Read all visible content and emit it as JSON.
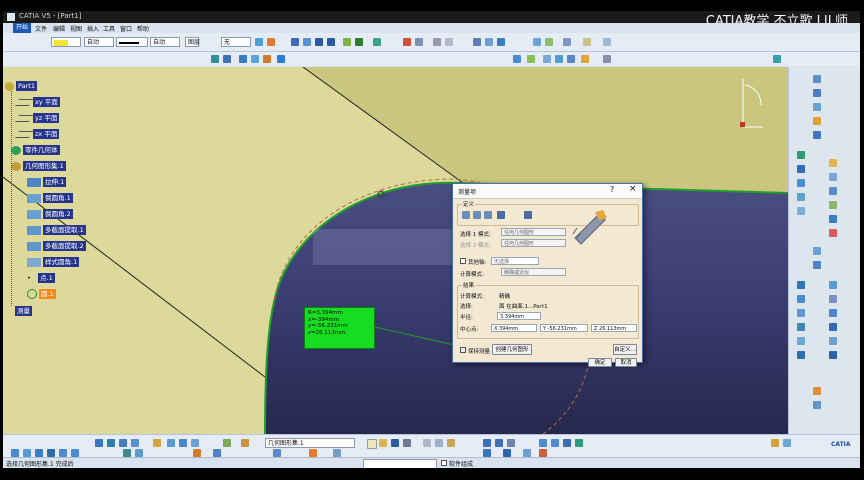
{
  "window": {
    "title": "CATIA V5 - [Part1]",
    "watermark": "CATIA教学 不立歌 LIL师"
  },
  "menu": {
    "start": "开始",
    "items": [
      "文件",
      "编辑",
      "视图",
      "插入",
      "工具",
      "窗口",
      "帮助"
    ]
  },
  "toolbar": {
    "color_select": "",
    "line_type": "自动",
    "line_weight": "自动",
    "layer_label": "图层",
    "layer_value": "无"
  },
  "tree": {
    "root": "Part1",
    "items": [
      {
        "label": "xy 平面",
        "level": 1
      },
      {
        "label": "yz 平面",
        "level": 1
      },
      {
        "label": "zx 平面",
        "level": 1
      },
      {
        "label": "零件几何体",
        "level": 1
      },
      {
        "label": "几何图形集.1",
        "level": 1
      },
      {
        "label": "拉伸.1",
        "level": 2
      },
      {
        "label": "倒圆角.1",
        "level": 2
      },
      {
        "label": "倒圆角.2",
        "level": 2
      },
      {
        "label": "多截面提取.1",
        "level": 2
      },
      {
        "label": "多截面提取.2",
        "level": 2
      },
      {
        "label": "样式圆角.1",
        "level": 2
      },
      {
        "label": "点.1",
        "level": 2
      },
      {
        "label": "圆.1",
        "level": 2,
        "highlight": true
      }
    ],
    "bottom": "测量"
  },
  "measure_overlay": {
    "lines": [
      "R=3.394mm",
      "x=-394mm",
      "y=-56.231mm",
      "z=26.113mm"
    ]
  },
  "dialog": {
    "title": "测量项",
    "help": "?",
    "close": "×",
    "definition_label": "定义",
    "selection1_label": "选择 1 模式:",
    "selection1_value": "任何几何图形",
    "selection2_label": "选择 2 模式:",
    "selection2_value": "任何几何图形",
    "other_axis_label": "其他轴:",
    "other_axis_value": "无选择",
    "calc_mode_label": "计算模式:",
    "calc_mode_value": "精确或近似",
    "result_label": "结果",
    "calc_mode_result_label": "计算模式:",
    "calc_mode_result_value": "精确",
    "selection_label": "选择:",
    "selection_value": "面 在曲面.1...Part1",
    "radius_label": "半径:",
    "radius_value": "3.394mm",
    "center_label": "中心点:",
    "center_x": "X 394mm",
    "center_y": "Y -56.231mm",
    "center_z": "Z 26.113mm",
    "keep_measure_label": "保持测量",
    "create_geometry_button": "创建几何图形",
    "customize_button": "自定义...",
    "ok_button": "确定",
    "cancel_button": "取消"
  },
  "status": {
    "text": "选择几何图形集.1 完成后",
    "field_placeholder": "",
    "check_label": "软件组成"
  },
  "colors": {
    "surface": "#d4d08f",
    "viewport_blue": "#4b4f86",
    "dialog_bg": "#f3e8d2",
    "measure_green": "#15dd1f",
    "highlight_orange": "#f28a1c",
    "tree_select": "#27348b"
  }
}
